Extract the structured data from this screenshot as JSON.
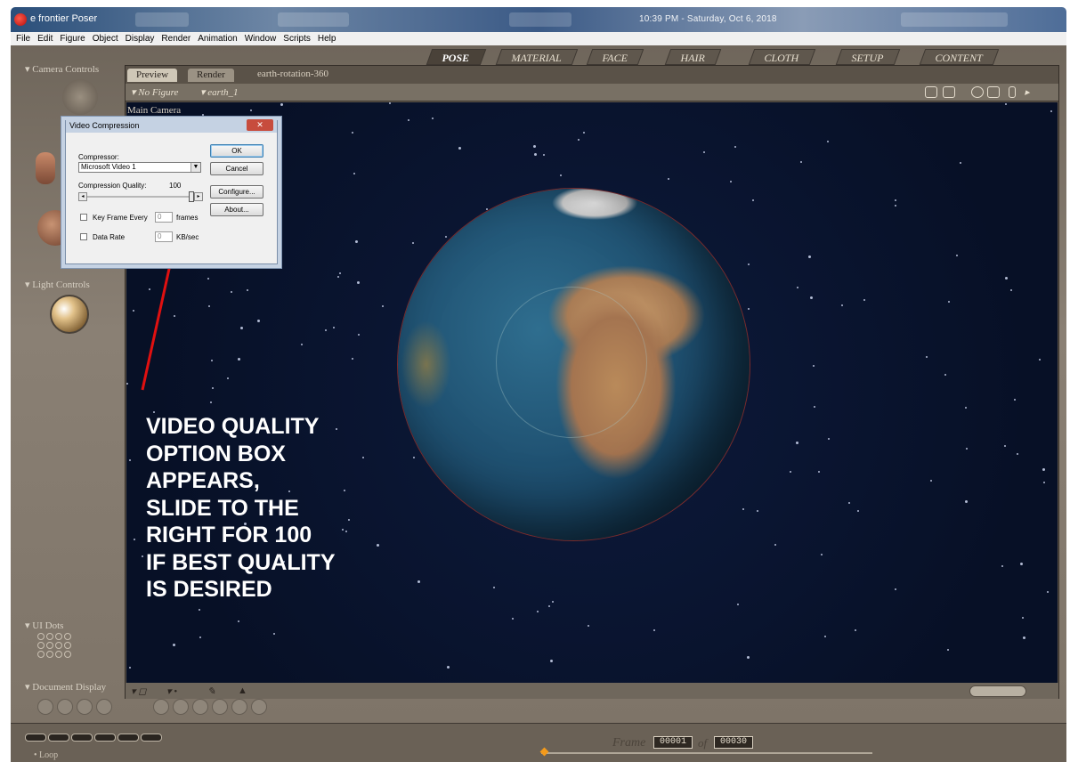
{
  "titlebar": {
    "app_title": "e frontier Poser",
    "clock": "10:39 PM - Saturday, Oct 6, 2018"
  },
  "menubar": {
    "items": [
      "File",
      "Edit",
      "Figure",
      "Object",
      "Display",
      "Render",
      "Animation",
      "Window",
      "Scripts",
      "Help"
    ]
  },
  "rooms": [
    "POSE",
    "MATERIAL",
    "FACE",
    "HAIR",
    "CLOTH",
    "SETUP",
    "CONTENT"
  ],
  "left_panels": {
    "camera_controls": "Camera Controls",
    "light_controls": "Light Controls",
    "ui_dots": "UI Dots",
    "document_display": "Document Display"
  },
  "document": {
    "tabs": [
      "Preview",
      "Render"
    ],
    "file_name": "earth-rotation-360",
    "figure_dropdown": "No Figure",
    "object_dropdown": "earth_1",
    "camera_label": "Main Camera"
  },
  "dialog": {
    "title": "Video Compression",
    "compressor_label": "Compressor:",
    "compressor_value": "Microsoft Video 1",
    "quality_label": "Compression Quality:",
    "quality_value": "100",
    "quality_level": 1.0,
    "keyframe_label": "Key Frame Every",
    "keyframe_value": "0",
    "keyframe_unit": "frames",
    "datarate_label": "Data Rate",
    "datarate_value": "0",
    "datarate_unit": "KB/sec",
    "buttons": {
      "ok": "OK",
      "cancel": "Cancel",
      "configure": "Configure...",
      "about": "About..."
    }
  },
  "annotation": {
    "lines": [
      "VIDEO QUALITY",
      "OPTION BOX",
      "APPEARS,",
      "SLIDE TO THE",
      "RIGHT FOR 100",
      "IF BEST QUALITY",
      "IS DESIRED"
    ],
    "arrow_color": "#e01010"
  },
  "bottom": {
    "frame_label": "Frame",
    "current_frame": "00001",
    "of_label": "of",
    "total_frames": "00030",
    "loop_label": "Loop"
  },
  "colors": {
    "viewport_bg": "#0a1430",
    "panel_bg": "#7a7064",
    "accent_orange": "#f39a1b"
  }
}
